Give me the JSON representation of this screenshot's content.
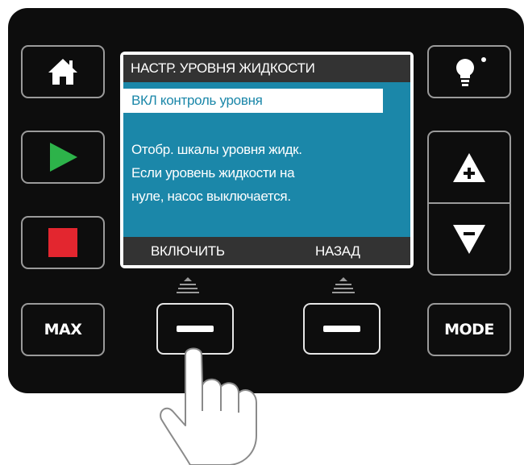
{
  "screen": {
    "title": "НАСТР. УРОВНЯ ЖИДКОСТИ",
    "selected_item": "ВКЛ контроль уровня",
    "description_lines": [
      "Отобр. шкалы уровня жидк.",
      "Если уровень жидкости на",
      "нуле, насос выключается."
    ],
    "softkey_left": "ВКЛЮЧИТЬ",
    "softkey_right": "НАЗАД"
  },
  "buttons": {
    "max_label": "MAX",
    "mode_label": "MODE"
  },
  "colors": {
    "panel": "#0d0d0d",
    "lcd_background": "#1b87a9",
    "lcd_bars": "#333333",
    "start_green": "#2db34a",
    "stop_red": "#e3262f",
    "button_border": "#9a9a9a"
  },
  "icons": [
    "home-icon",
    "play-icon",
    "stop-icon",
    "light-bulb-icon",
    "plus-triangle-icon",
    "minus-triangle-icon",
    "softkey-dash-icon",
    "pointing-hand-icon"
  ]
}
